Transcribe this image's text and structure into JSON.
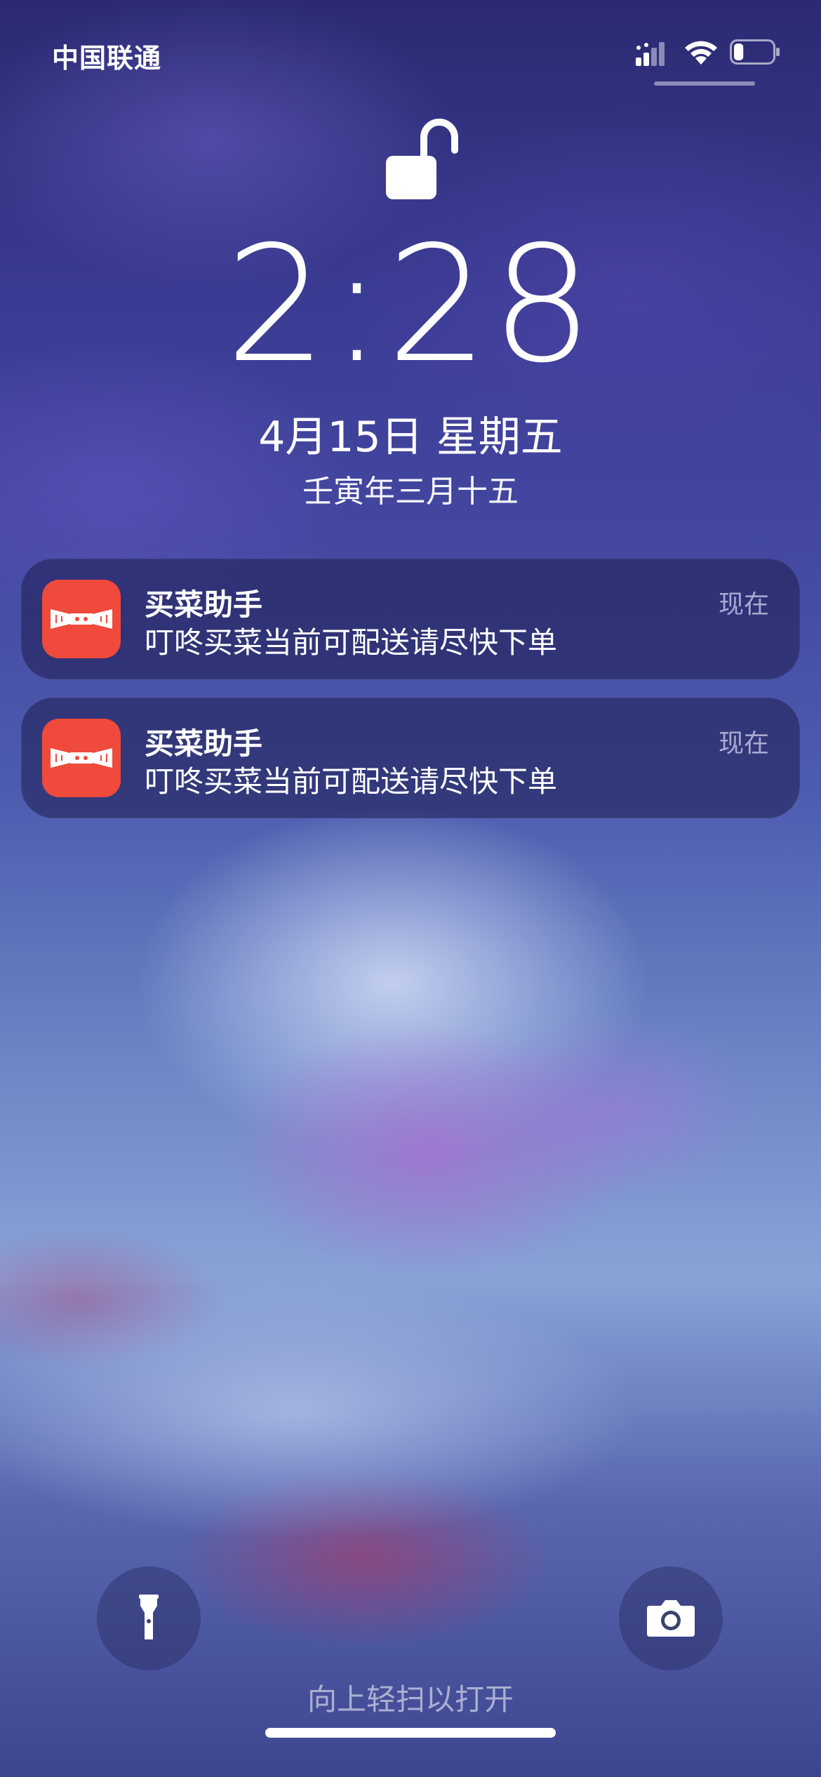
{
  "status_bar": {
    "carrier": "中国联通",
    "signal_icon": "cellular-signal-icon",
    "wifi_icon": "wifi-icon",
    "battery_icon": "battery-icon",
    "battery_level": 0.25
  },
  "lock_screen": {
    "lock_icon": "unlocked-padlock-icon",
    "time": "2:28",
    "date": "4月15日 星期五",
    "lunar_date": "壬寅年三月十五"
  },
  "notifications": [
    {
      "app_name": "买菜助手",
      "message": "叮咚买菜当前可配送请尽快下单",
      "time": "现在",
      "icon": "shopping-helper-app-icon"
    },
    {
      "app_name": "买菜助手",
      "message": "叮咚买菜当前可配送请尽快下单",
      "time": "现在",
      "icon": "shopping-helper-app-icon"
    }
  ],
  "bottom_controls": {
    "flashlight_icon": "flashlight-icon",
    "camera_icon": "camera-icon",
    "swipe_hint": "向上轻扫以打开"
  },
  "colors": {
    "app_icon_red": "#ef4a3b",
    "notification_bg": "rgba(30,30,80,0.55)"
  }
}
